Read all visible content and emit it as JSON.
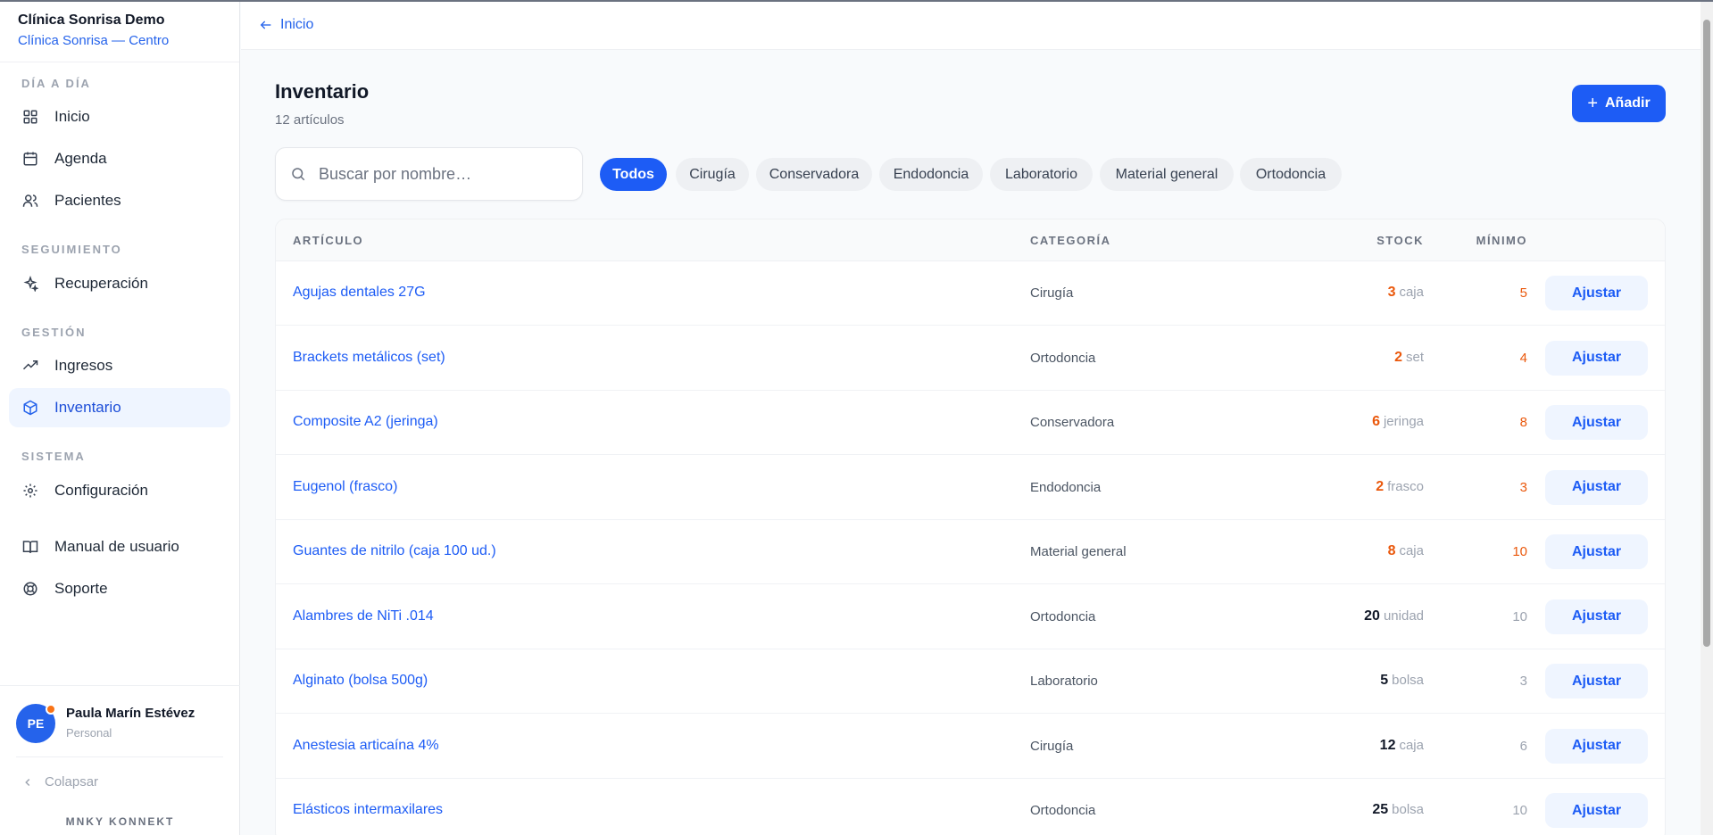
{
  "sidebar": {
    "brand_name": "Clínica Sonrisa Demo",
    "brand_sub": "Clínica Sonrisa — Centro",
    "sections": {
      "dia": "DÍA A DÍA",
      "seguimiento": "SEGUIMIENTO",
      "gestion": "GESTIÓN",
      "sistema": "SISTEMA"
    },
    "items": {
      "inicio": {
        "label": "Inicio",
        "icon": "grid-icon"
      },
      "agenda": {
        "label": "Agenda",
        "icon": "calendar-icon"
      },
      "pacientes": {
        "label": "Pacientes",
        "icon": "users-icon"
      },
      "recuperacion": {
        "label": "Recuperación",
        "icon": "sparkles-icon"
      },
      "ingresos": {
        "label": "Ingresos",
        "icon": "trending-up-icon"
      },
      "inventario": {
        "label": "Inventario",
        "icon": "package-icon"
      },
      "configuracion": {
        "label": "Configuración",
        "icon": "gear-icon"
      },
      "manual": {
        "label": "Manual de usuario",
        "icon": "book-icon"
      },
      "soporte": {
        "label": "Soporte",
        "icon": "lifebuoy-icon"
      }
    },
    "active_item": "Inventario",
    "user": {
      "initials": "PE",
      "name": "Paula Marín Estévez",
      "role": "Personal"
    },
    "collapse_label": "Colapsar",
    "footer_brand": "MNKY KONNEKT"
  },
  "topbar": {
    "back_label": "Inicio"
  },
  "page": {
    "title": "Inventario",
    "subtitle": "12 artículos",
    "add_label": "Añadir"
  },
  "search": {
    "placeholder": "Buscar por nombre…",
    "value": ""
  },
  "filters": [
    "Todos",
    "Cirugía",
    "Conservadora",
    "Endodoncia",
    "Laboratorio",
    "Material general",
    "Ortodoncia"
  ],
  "active_filter": "Todos",
  "table": {
    "headers": {
      "articulo": "ARTÍCULO",
      "categoria": "CATEGORÍA",
      "stock": "STOCK",
      "minimo": "MÍNIMO"
    },
    "adjust_label": "Ajustar",
    "rows": [
      {
        "name": "Agujas dentales 27G",
        "category": "Cirugía",
        "stock": "3",
        "unit": "caja",
        "min": "5",
        "low": true
      },
      {
        "name": "Brackets metálicos (set)",
        "category": "Ortodoncia",
        "stock": "2",
        "unit": "set",
        "min": "4",
        "low": true
      },
      {
        "name": "Composite A2 (jeringa)",
        "category": "Conservadora",
        "stock": "6",
        "unit": "jeringa",
        "min": "8",
        "low": true
      },
      {
        "name": "Eugenol (frasco)",
        "category": "Endodoncia",
        "stock": "2",
        "unit": "frasco",
        "min": "3",
        "low": true
      },
      {
        "name": "Guantes de nitrilo (caja 100 ud.)",
        "category": "Material general",
        "stock": "8",
        "unit": "caja",
        "min": "10",
        "low": true
      },
      {
        "name": "Alambres de NiTi .014",
        "category": "Ortodoncia",
        "stock": "20",
        "unit": "unidad",
        "min": "10",
        "low": false
      },
      {
        "name": "Alginato (bolsa 500g)",
        "category": "Laboratorio",
        "stock": "5",
        "unit": "bolsa",
        "min": "3",
        "low": false
      },
      {
        "name": "Anestesia articaína 4%",
        "category": "Cirugía",
        "stock": "12",
        "unit": "caja",
        "min": "6",
        "low": false
      },
      {
        "name": "Elásticos intermaxilares",
        "category": "Ortodoncia",
        "stock": "25",
        "unit": "bolsa",
        "min": "10",
        "low": false
      }
    ]
  },
  "colors": {
    "accent": "#1d5cf5",
    "low_stock": "#ea580c",
    "active_bg": "#eff5ff"
  }
}
